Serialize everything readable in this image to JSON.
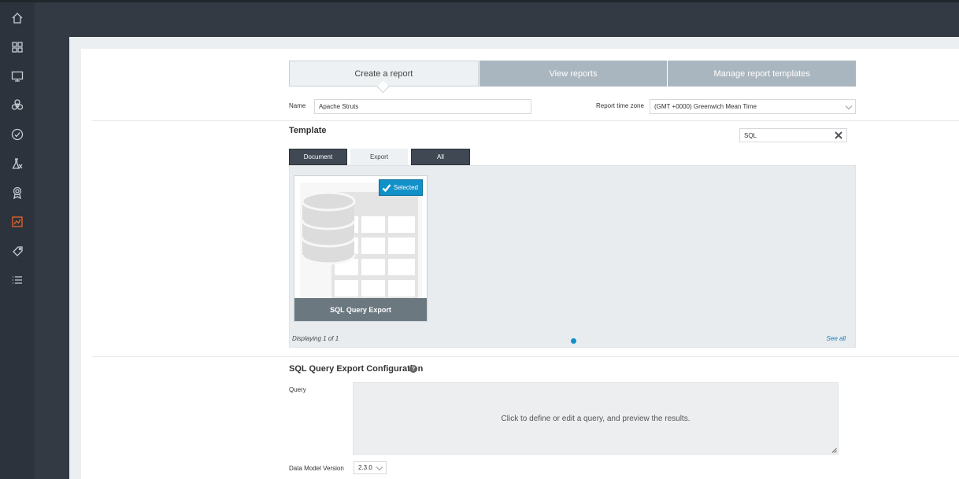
{
  "sidebar": {
    "items": [
      {
        "icon": "home-icon"
      },
      {
        "icon": "dashboard-icon"
      },
      {
        "icon": "monitor-icon"
      },
      {
        "icon": "biohazard-icon"
      },
      {
        "icon": "check-circle-icon"
      },
      {
        "icon": "flask-icon"
      },
      {
        "icon": "award-icon"
      },
      {
        "icon": "reports-icon",
        "active": true
      },
      {
        "icon": "tag-icon"
      },
      {
        "icon": "list-icon"
      }
    ],
    "active_color": "#e8642c"
  },
  "tabs": [
    {
      "label": "Create a report",
      "active": true
    },
    {
      "label": "View reports",
      "active": false
    },
    {
      "label": "Manage report templates",
      "active": false
    }
  ],
  "form": {
    "name_label": "Name",
    "name_value": "Apache Struts",
    "timezone_label": "Report time zone",
    "timezone_value": "(GMT +0000) Greenwich Mean Time"
  },
  "template": {
    "title": "Template",
    "search_value": "SQL",
    "filters": [
      {
        "label": "Document"
      },
      {
        "label": "Export"
      },
      {
        "label": "All"
      }
    ],
    "cards": [
      {
        "title": "SQL Query Export",
        "selected_label": "Selected"
      }
    ],
    "display_count": "Displaying 1 of 1",
    "see_all": "See all"
  },
  "config": {
    "title": "SQL Query Export Configuration",
    "help": "?",
    "query_label": "Query",
    "query_placeholder": "Click to define or edit a query, and preview the results.",
    "version_label": "Data Model Version",
    "version_value": "2.3.0"
  },
  "colors": {
    "accent": "#1290c8",
    "sidebar": "#2d333c",
    "tab_inactive": "#aab6bf",
    "card_footer": "#6b7880"
  }
}
